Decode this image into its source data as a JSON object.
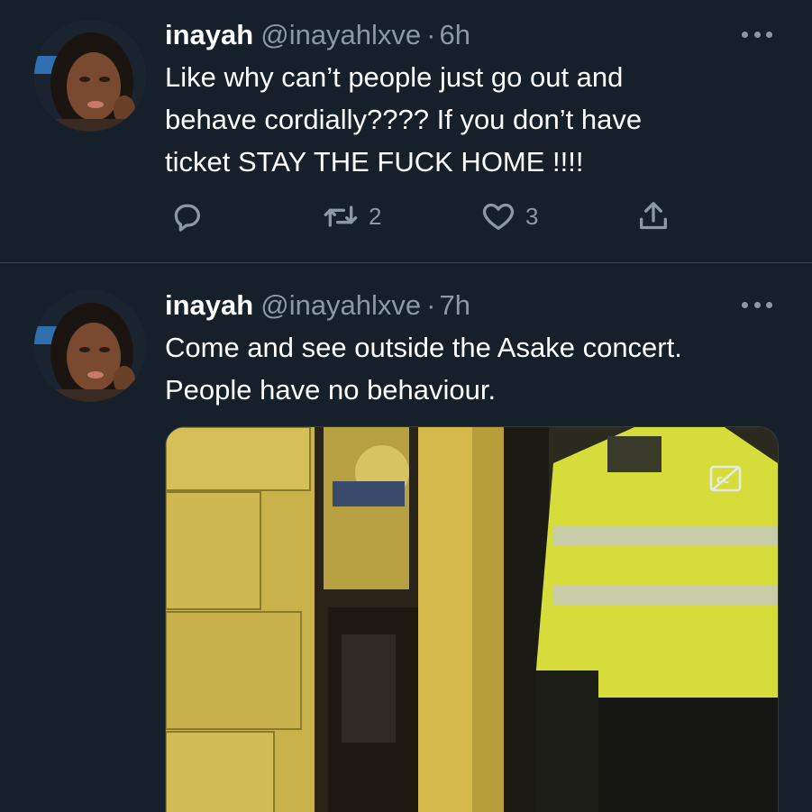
{
  "colors": {
    "background": "#15202b",
    "divider": "#38444d",
    "primary_text": "#ffffff",
    "secondary_text": "#8b98a5"
  },
  "tweets": [
    {
      "display_name": "inayah",
      "handle": "@inayahlxve",
      "separator": "·",
      "time": "6h",
      "text": "Like why can’t people just go out and\nbehave cordially???? If you don’t have\nticket STAY THE FUCK HOME !!!!",
      "avatar_icon": "avatar-portrait",
      "more_icon": "more-dots-icon",
      "actions": {
        "reply": {
          "icon": "reply-icon",
          "count": ""
        },
        "retweet": {
          "icon": "retweet-icon",
          "count": "2"
        },
        "like": {
          "icon": "heart-icon",
          "count": "3"
        },
        "share": {
          "icon": "share-icon",
          "count": ""
        }
      }
    },
    {
      "display_name": "inayah",
      "handle": "@inayahlxve",
      "separator": "·",
      "time": "7h",
      "text": "Come and see outside the Asake concert.\nPeople have no behaviour.",
      "avatar_icon": "avatar-portrait",
      "more_icon": "more-dots-icon",
      "media": {
        "kind": "video-thumbnail",
        "captions_icon": "closed-captions-off-icon"
      }
    }
  ]
}
